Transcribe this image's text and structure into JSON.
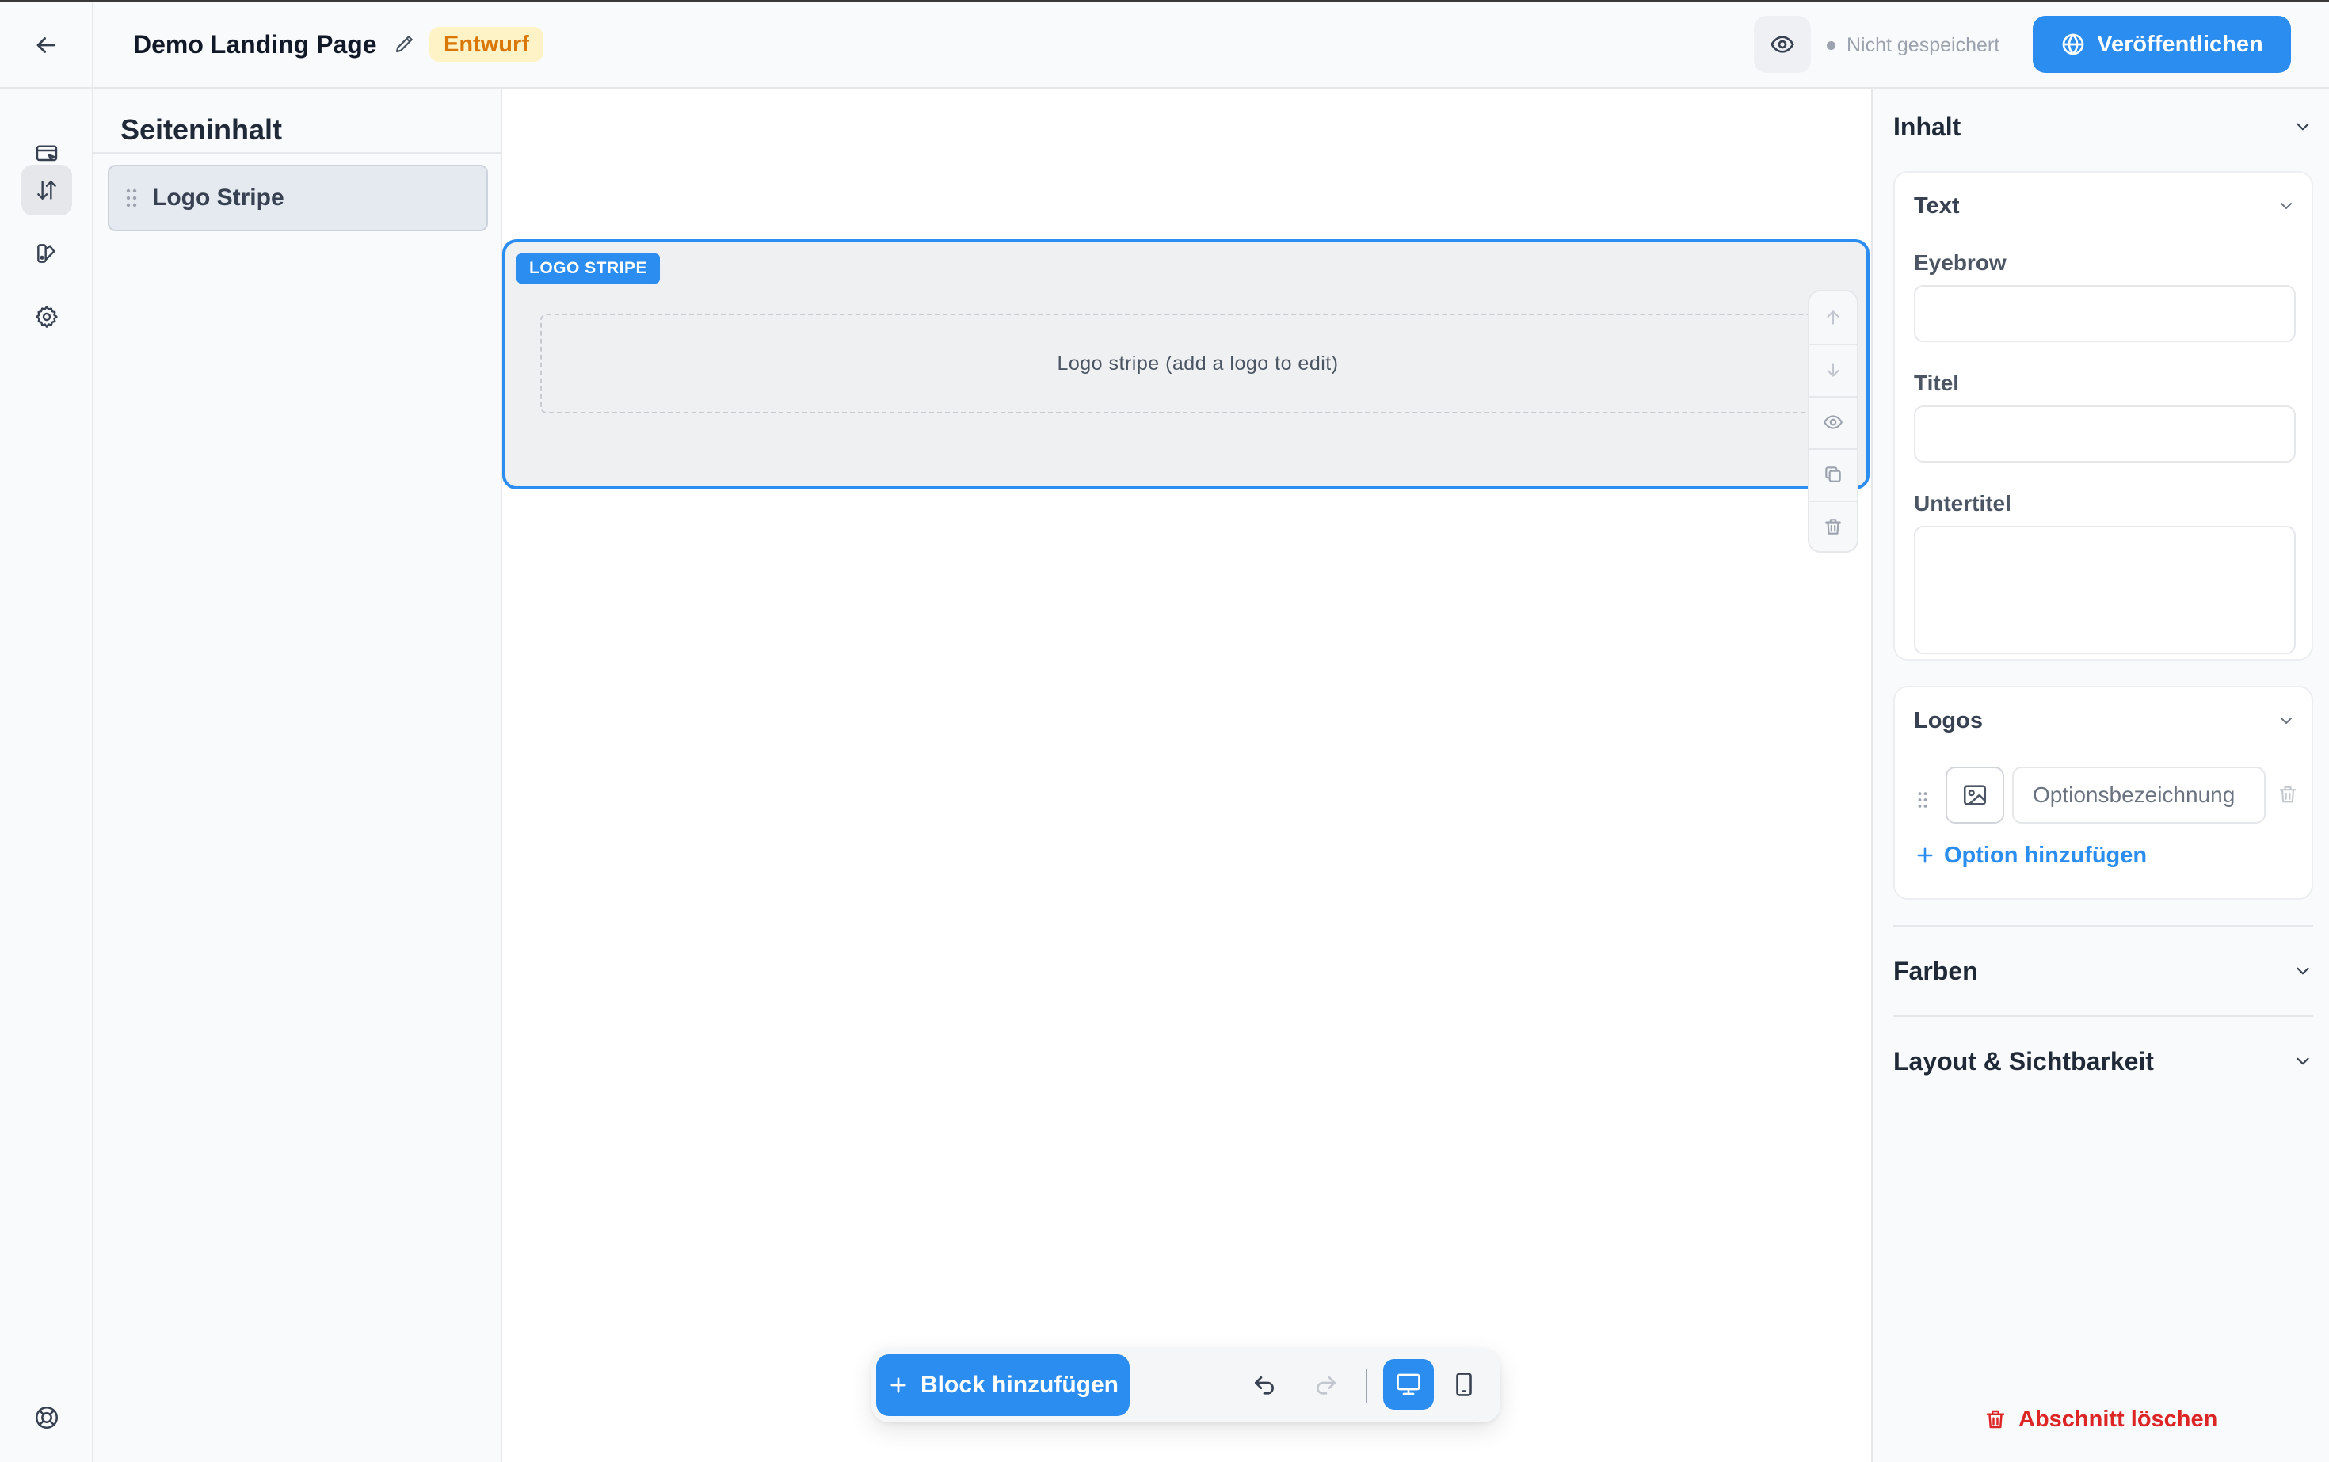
{
  "header": {
    "page_title": "Demo Landing Page",
    "status_badge": "Entwurf",
    "save_status": "Nicht gespeichert",
    "publish_label": "Veröffentlichen"
  },
  "structure": {
    "title": "Seiteninhalt",
    "items": [
      {
        "label": "Logo Stripe"
      }
    ]
  },
  "canvas": {
    "block_tag": "LOGO STRIPE",
    "block_placeholder": "Logo stripe (add a logo to edit)"
  },
  "bottom_toolbar": {
    "add_block_label": "Block hinzufügen"
  },
  "inspector": {
    "content_section": "Inhalt",
    "text_card": {
      "title": "Text",
      "eyebrow_label": "Eyebrow",
      "eyebrow_value": "",
      "title_label": "Titel",
      "title_value": "",
      "subtitle_label": "Untertitel",
      "subtitle_value": ""
    },
    "logos_card": {
      "title": "Logos",
      "option_placeholder": "Optionsbezeichnung",
      "add_option_label": "Option hinzufügen"
    },
    "colors_section": "Farben",
    "layout_section": "Layout & Sichtbarkeit",
    "delete_section_label": "Abschnitt löschen"
  },
  "colors": {
    "accent": "#2b8def",
    "draft_bg": "#fef3c7",
    "draft_text": "#d97706",
    "danger": "#dc2626"
  },
  "icons": {
    "back": "arrow-left-icon",
    "edit": "pencil-icon",
    "preview": "eye-icon",
    "publish": "globe-icon",
    "rail": [
      "browser-cursor-icon",
      "sort-arrows-icon",
      "palette-icon",
      "gear-icon",
      "lifebuoy-icon"
    ],
    "block_tools": [
      "arrow-up-icon",
      "arrow-down-icon",
      "eye-icon",
      "copy-icon",
      "trash-icon"
    ],
    "bottom": [
      "plus-icon",
      "undo-icon",
      "redo-icon",
      "desktop-icon",
      "tablet-icon"
    ]
  }
}
